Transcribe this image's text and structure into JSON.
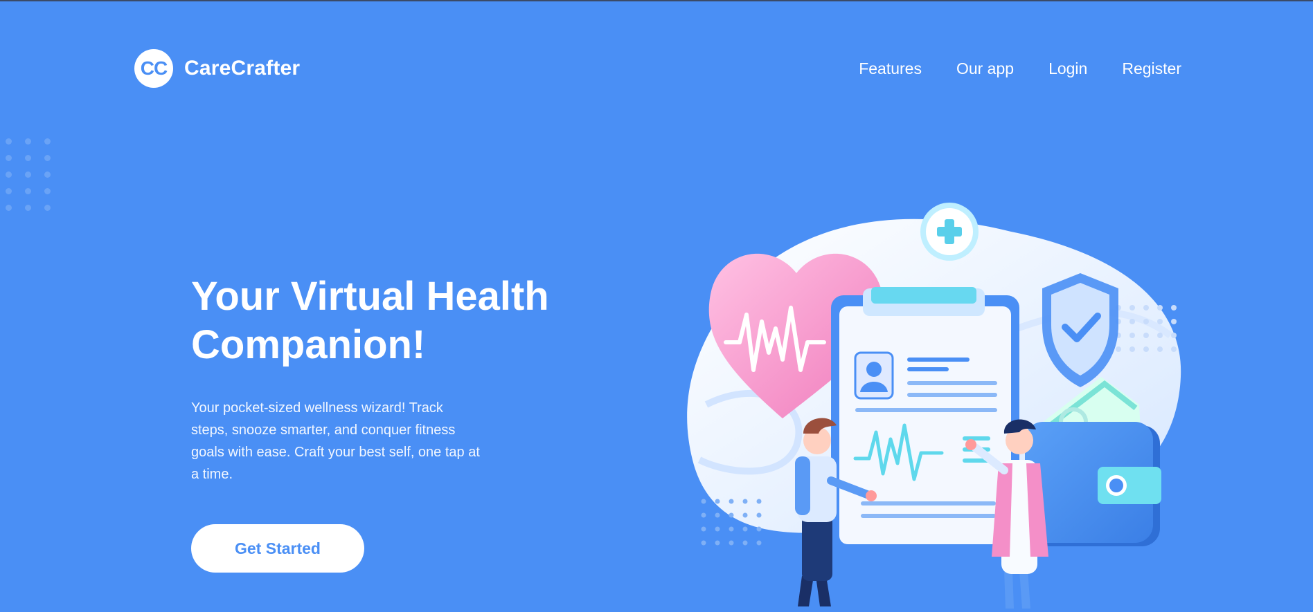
{
  "brand": {
    "logo_text": "CC",
    "name": "CareCrafter"
  },
  "nav": {
    "items": [
      "Features",
      "Our app",
      "Login",
      "Register"
    ]
  },
  "hero": {
    "title_line1": "Your Virtual Health",
    "title_line2": "Companion!",
    "description": "Your pocket-sized wellness wizard! Track steps, snooze smarter, and conquer fitness goals with ease. Craft your best self, one tap at a time.",
    "cta_label": "Get Started"
  },
  "colors": {
    "background": "#4a8ff5",
    "text": "#ffffff",
    "accent_pink": "#f48fc8",
    "accent_cyan": "#5fd8ec"
  },
  "illustration": {
    "icons": [
      "heart-pulse-icon",
      "medical-cross-icon",
      "shield-check-icon",
      "clipboard-icon",
      "wallet-icon",
      "doctor-figure",
      "patient-figure"
    ]
  }
}
